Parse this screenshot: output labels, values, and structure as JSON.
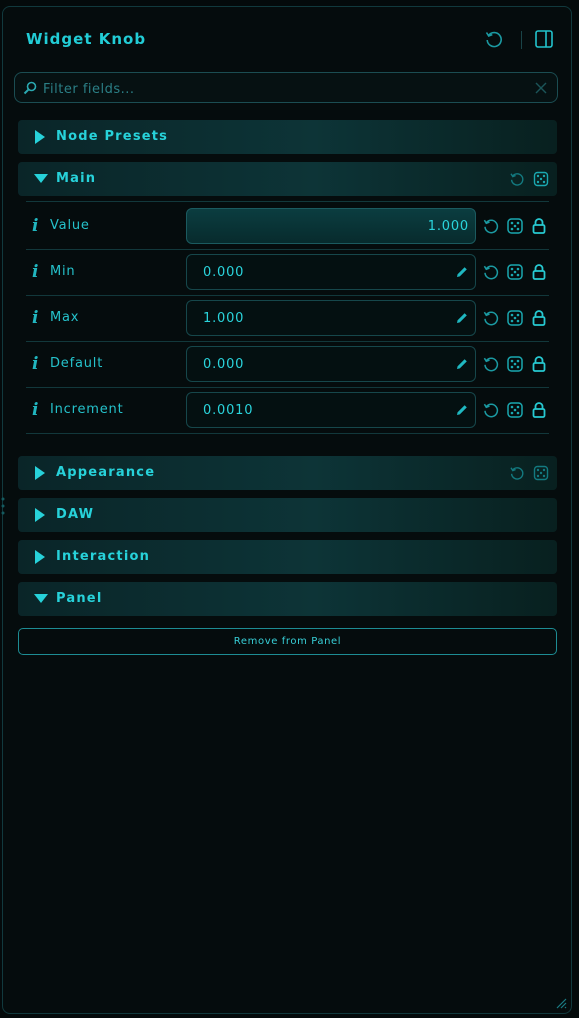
{
  "header": {
    "title": "Widget Knob"
  },
  "filter": {
    "placeholder": "Filter fields..."
  },
  "sections": {
    "node_presets": "Node Presets",
    "main": "Main",
    "appearance": "Appearance",
    "daw": "DAW",
    "interaction": "Interaction",
    "panel": "Panel"
  },
  "main_fields": [
    {
      "label": "Value",
      "value": "1.000"
    },
    {
      "label": "Min",
      "value": "0.000"
    },
    {
      "label": "Max",
      "value": "1.000"
    },
    {
      "label": "Default",
      "value": "0.000"
    },
    {
      "label": "Increment",
      "value": "0.0010"
    }
  ],
  "info_glyph": "i",
  "panel_section": {
    "remove_label": "Remove from Panel"
  },
  "colors": {
    "accent": "#1ec8d2",
    "background": "#040a0b",
    "section_bg": "#0d3437"
  }
}
